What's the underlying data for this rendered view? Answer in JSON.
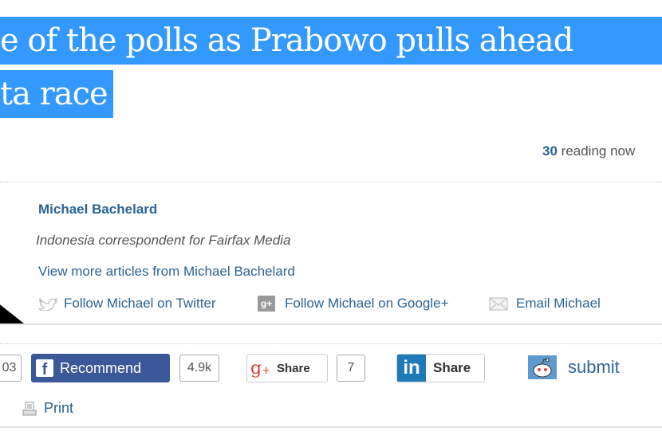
{
  "headline": {
    "line1": "e of the polls as Prabowo pulls ahead",
    "line2": "ta race"
  },
  "readers": {
    "count": "30",
    "label": "reading now"
  },
  "author": {
    "name": "Michael Bachelard",
    "title": "Indonesia correspondent for Fairfax Media",
    "more_articles": "View more articles from Michael Bachelard",
    "twitter": "Follow Michael on Twitter",
    "google": "Follow Michael on Google+",
    "email": "Email Michael"
  },
  "share": {
    "partial_count": "03",
    "facebook_label": "Recommend",
    "facebook_count": "4.9k",
    "gplus_label": "Share",
    "gplus_count": "7",
    "linkedin_label": "Share",
    "reddit_label": "submit",
    "print_label": "Print"
  },
  "colors": {
    "selection": "#3399ff",
    "link": "#2a6496",
    "facebook": "#3b5998"
  }
}
